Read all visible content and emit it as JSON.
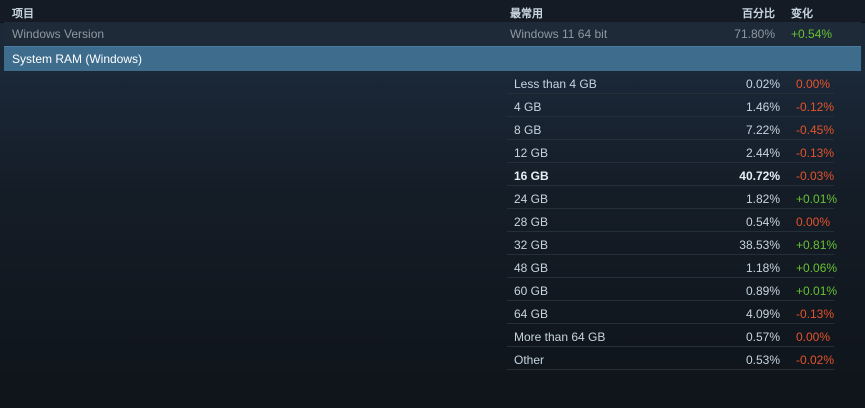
{
  "header": {
    "item": "项目",
    "most_popular": "最常用",
    "percent": "百分比",
    "change": "变化"
  },
  "windows_version": {
    "label": "Windows Version",
    "most_popular": "Windows 11 64 bit",
    "percent": "71.80%",
    "change": "+0.54%"
  },
  "section": {
    "title": "System RAM (Windows)"
  },
  "ram_rows": [
    {
      "name": "Less than 4 GB",
      "percent": "0.02%",
      "change": "0.00%",
      "trend": "neg"
    },
    {
      "name": "4 GB",
      "percent": "1.46%",
      "change": "-0.12%",
      "trend": "neg"
    },
    {
      "name": "8 GB",
      "percent": "7.22%",
      "change": "-0.45%",
      "trend": "neg"
    },
    {
      "name": "12 GB",
      "percent": "2.44%",
      "change": "-0.13%",
      "trend": "neg"
    },
    {
      "name": "16 GB",
      "percent": "40.72%",
      "change": "-0.03%",
      "trend": "neg",
      "highlight": true
    },
    {
      "name": "24 GB",
      "percent": "1.82%",
      "change": "+0.01%",
      "trend": "pos"
    },
    {
      "name": "28 GB",
      "percent": "0.54%",
      "change": "0.00%",
      "trend": "neg"
    },
    {
      "name": "32 GB",
      "percent": "38.53%",
      "change": "+0.81%",
      "trend": "pos"
    },
    {
      "name": "48 GB",
      "percent": "1.18%",
      "change": "+0.06%",
      "trend": "pos"
    },
    {
      "name": "60 GB",
      "percent": "0.89%",
      "change": "+0.01%",
      "trend": "pos"
    },
    {
      "name": "64 GB",
      "percent": "4.09%",
      "change": "-0.13%",
      "trend": "neg"
    },
    {
      "name": "More than 64 GB",
      "percent": "0.57%",
      "change": "0.00%",
      "trend": "neg"
    },
    {
      "name": "Other",
      "percent": "0.53%",
      "change": "-0.02%",
      "trend": "neg"
    }
  ],
  "colors": {
    "positive": "#66c232",
    "negative": "#e5532b",
    "section_bar": "#3d6c8d"
  }
}
